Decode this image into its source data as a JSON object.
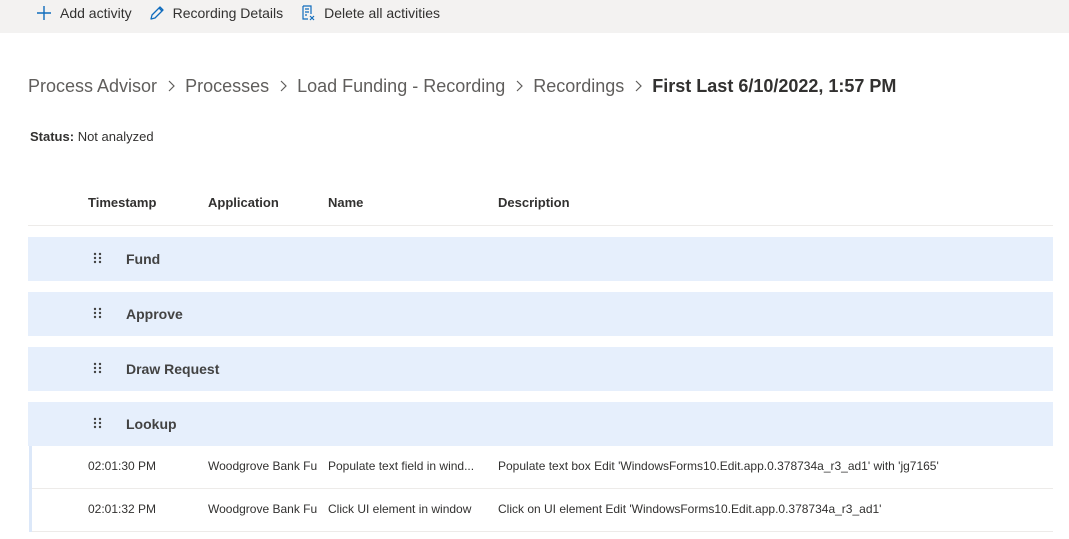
{
  "toolbar": {
    "add_activity": "Add activity",
    "recording_details": "Recording Details",
    "delete_all": "Delete all activities"
  },
  "breadcrumb": {
    "items": [
      "Process Advisor",
      "Processes",
      "Load Funding - Recording",
      "Recordings"
    ],
    "current": "First Last 6/10/2022, 1:57 PM"
  },
  "status": {
    "label": "Status:",
    "value": "Not analyzed"
  },
  "table": {
    "columns": [
      "Timestamp",
      "Application",
      "Name",
      "Description"
    ],
    "groups": [
      "Fund",
      "Approve",
      "Draw Request",
      "Lookup"
    ],
    "rows": [
      {
        "timestamp": "02:01:30 PM",
        "application": "Woodgrove Bank Fu",
        "name": "Populate text field in wind...",
        "description": "Populate text box Edit 'WindowsForms10.Edit.app.0.378734a_r3_ad1' with 'jg7165'"
      },
      {
        "timestamp": "02:01:32 PM",
        "application": "Woodgrove Bank Fu",
        "name": "Click UI element in window",
        "description": "Click on UI element Edit 'WindowsForms10.Edit.app.0.378734a_r3_ad1'"
      }
    ]
  },
  "colors": {
    "group_bg": "#e6effc",
    "accent": "#0f6cbd",
    "toolbar_bg": "#f3f2f1"
  }
}
